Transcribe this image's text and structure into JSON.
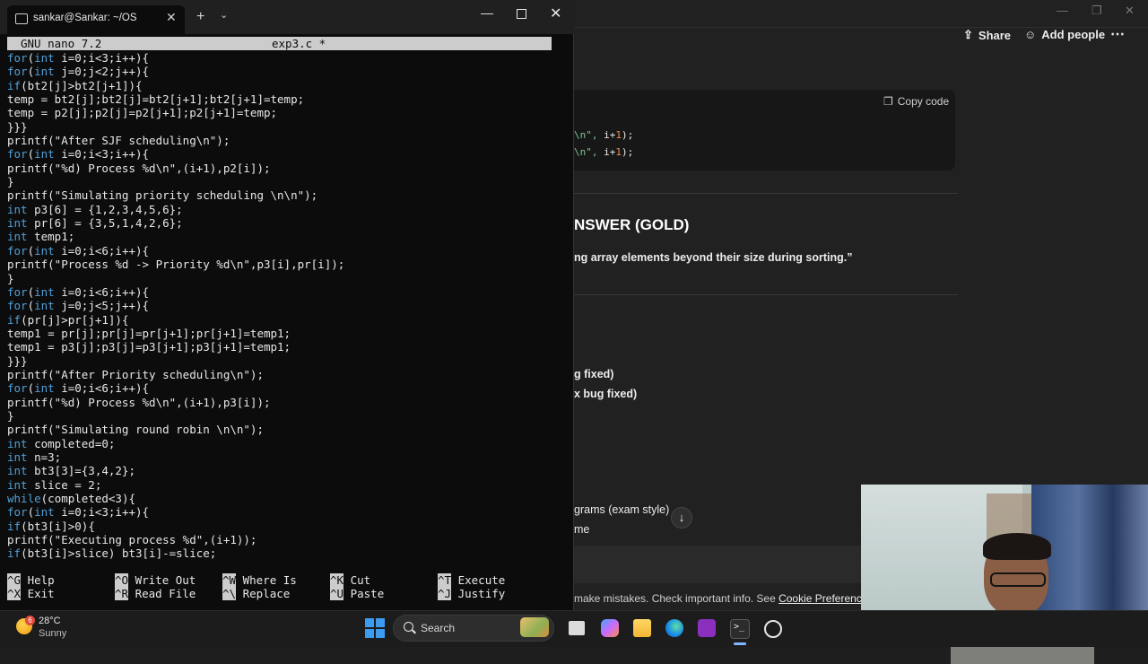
{
  "terminal": {
    "tab_title": "sankar@Sankar: ~/OS",
    "nano_version": "GNU nano 7.2",
    "nano_file": "exp3.c *",
    "code_lines": [
      "for(int i=0;i<3;i++){",
      "for(int j=0;j<2;j++){",
      "if(bt2[j]>bt2[j+1]){",
      "temp = bt2[j];bt2[j]=bt2[j+1];bt2[j+1]=temp;",
      "temp = p2[j];p2[j]=p2[j+1];p2[j+1]=temp;",
      "}}}",
      "printf(\"After SJF scheduling\\n\");",
      "for(int i=0;i<3;i++){",
      "printf(\"%d) Process %d\\n\",(i+1),p2[i]);",
      "}",
      "printf(\"Simulating priority scheduling \\n\\n\");",
      "int p3[6] = {1,2,3,4,5,6};",
      "int pr[6] = {3,5,1,4,2,6};",
      "int temp1;",
      "for(int i=0;i<6;i++){",
      "printf(\"Process %d -> Priority %d\\n\",p3[i],pr[i]);",
      "}",
      "for(int i=0;i<6;i++){",
      "for(int j=0;j<5;j++){",
      "if(pr[j]>pr[j+1]){",
      "temp1 = pr[j];pr[j]=pr[j+1];pr[j+1]=temp1;",
      "temp1 = p3[j];p3[j]=p3[j+1];p3[j+1]=temp1;",
      "}}}",
      "printf(\"After Priority scheduling\\n\");",
      "for(int i=0;i<6;i++){",
      "printf(\"%d) Process %d\\n\",(i+1),p3[i]);",
      "}",
      "printf(\"Simulating round robin \\n\\n\");",
      "int completed=0;",
      "int n=3;",
      "int bt3[3]={3,4,2};",
      "int slice = 2;",
      "while(completed<3){",
      "for(int i=0;i<3;i++){",
      "if(bt3[i]>0){",
      "printf(\"Executing process %d\",(i+1));",
      "if(bt3[i]>slice) bt3[i]-=slice;"
    ],
    "shortcuts": [
      {
        "key": "^G",
        "label": "Help"
      },
      {
        "key": "^O",
        "label": "Write Out"
      },
      {
        "key": "^W",
        "label": "Where Is"
      },
      {
        "key": "^K",
        "label": "Cut"
      },
      {
        "key": "^T",
        "label": "Execute"
      },
      {
        "key": "^X",
        "label": "Exit"
      },
      {
        "key": "^R",
        "label": "Read File"
      },
      {
        "key": "^\\",
        "label": "Replace"
      },
      {
        "key": "^U",
        "label": "Paste"
      },
      {
        "key": "^J",
        "label": "Justify"
      }
    ]
  },
  "browser": {
    "share_label": "Share",
    "add_people_label": "Add people",
    "more_label": "⋯",
    "copy_code_label": "Copy code",
    "code_snippet_1_pre": "\\n\", ",
    "code_snippet_1_mid": "i+",
    "code_snippet_1_num": "1",
    "code_snippet_1_post": ");",
    "answer_heading": "NSWER (GOLD)",
    "answer_quote": "ng array elements beyond their size during sorting.”",
    "fragment_1": "g fixed)",
    "fragment_2": "x bug fixed)",
    "fragment_exam": "grams (exam style)",
    "fragment_me": "me",
    "disclaimer_text": "make mistakes. Check important info. See ",
    "disclaimer_link": "Cookie Preferences",
    "disclaimer_end": "."
  },
  "taskbar": {
    "weather_badge": "6",
    "weather_temp": "28°C",
    "weather_desc": "Sunny",
    "search_label": "Search"
  },
  "colors": {
    "keyword": "#4fa0d8",
    "terminal_bg": "#0c0c0c",
    "nano_bar": "#cccccc",
    "page_bg": "#212121"
  }
}
